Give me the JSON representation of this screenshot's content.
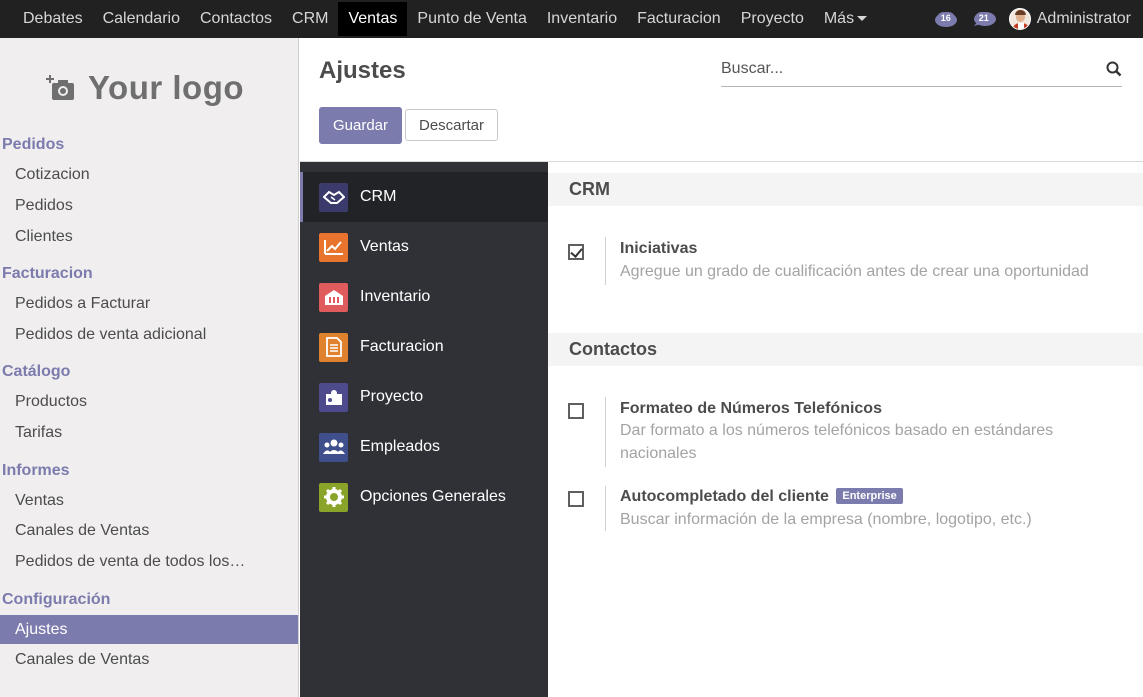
{
  "topbar": {
    "menu": [
      "Debates",
      "Calendario",
      "Contactos",
      "CRM",
      "Ventas",
      "Punto de Venta",
      "Inventario",
      "Facturacion",
      "Proyecto",
      "Más"
    ],
    "active_menu": "Ventas",
    "discuss_badge": "16",
    "chat_badge": "21",
    "username": "Administrator"
  },
  "sidebar": {
    "logo_text": "Your logo",
    "sections": [
      {
        "title": "Pedidos",
        "items": [
          "Cotizacion",
          "Pedidos",
          "Clientes"
        ]
      },
      {
        "title": "Facturacion",
        "items": [
          "Pedidos a Facturar",
          "Pedidos de venta adicional"
        ]
      },
      {
        "title": "Catálogo",
        "items": [
          "Productos",
          "Tarifas"
        ]
      },
      {
        "title": "Informes",
        "items": [
          "Ventas",
          "Canales de Ventas",
          "Pedidos de venta de todos los…"
        ]
      },
      {
        "title": "Configuración",
        "items": [
          "Ajustes",
          "Canales de Ventas"
        ]
      }
    ],
    "active_item": "Ajustes"
  },
  "control": {
    "title": "Ajustes",
    "search_placeholder": "Buscar...",
    "save_label": "Guardar",
    "discard_label": "Descartar"
  },
  "apps": [
    {
      "label": "CRM",
      "icon": "handshake-icon",
      "color": "#3b3b6b"
    },
    {
      "label": "Ventas",
      "icon": "chart-line-icon",
      "color": "#e8742d"
    },
    {
      "label": "Inventario",
      "icon": "building-icon",
      "color": "#e05c5c"
    },
    {
      "label": "Facturacion",
      "icon": "document-icon",
      "color": "#e0822d"
    },
    {
      "label": "Proyecto",
      "icon": "puzzle-icon",
      "color": "#4e4b8c"
    },
    {
      "label": "Empleados",
      "icon": "users-icon",
      "color": "#3f4f8c"
    },
    {
      "label": "Opciones Generales",
      "icon": "gear-icon",
      "color": "#8aa329"
    }
  ],
  "active_app": "CRM",
  "content": {
    "sections": [
      {
        "title": "CRM",
        "settings": [
          {
            "title": "Iniciativas",
            "desc": "Agregue un grado de cualificación antes de crear una oportunidad",
            "checked": true
          }
        ]
      },
      {
        "title": "Contactos",
        "settings": [
          {
            "title": "Formateo de Números Telefónicos",
            "desc": "Dar formato a los números telefónicos basado en estándares nacionales",
            "checked": false
          },
          {
            "title": "Autocompletado del cliente",
            "badge": "Enterprise",
            "desc": "Buscar información de la empresa (nombre, logotipo, etc.)",
            "checked": false
          }
        ]
      }
    ]
  },
  "colors": {
    "accent": "#7c7bad",
    "topbar": "#212121",
    "app_panel": "#2f3136"
  }
}
